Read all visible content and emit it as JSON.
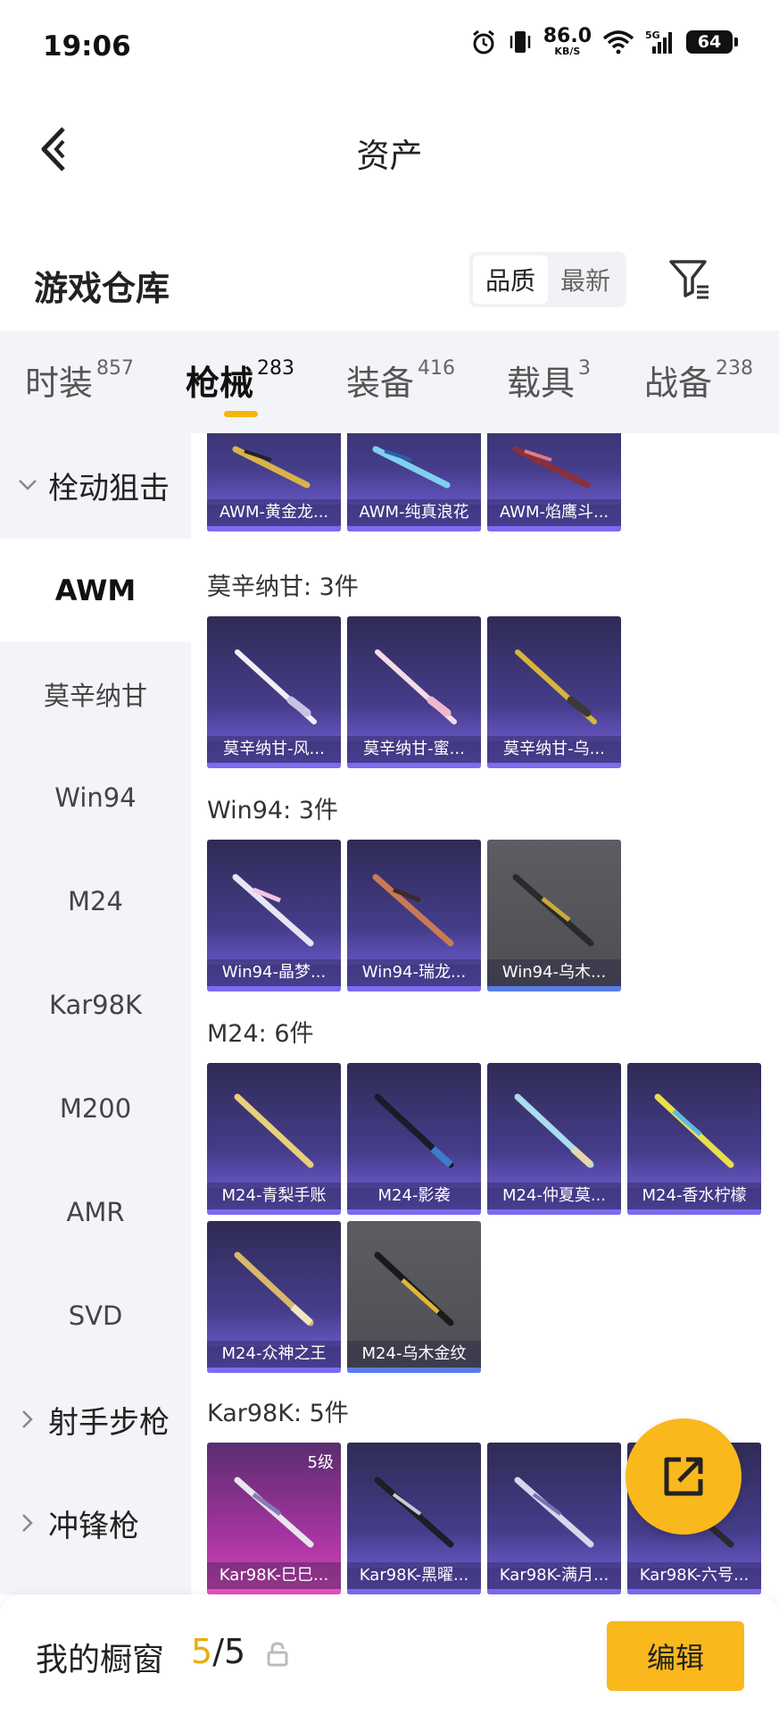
{
  "status_bar": {
    "time": "19:06",
    "net_speed": "86.0",
    "net_unit": "KB/S",
    "signal_label": "5G",
    "battery": "64",
    "icons": [
      "alarm-icon",
      "vibrate-icon",
      "wifi-icon",
      "signal-icon",
      "battery-icon"
    ]
  },
  "nav": {
    "title": "资产",
    "back_icon": "back-arrow-icon"
  },
  "warehouse": {
    "title": "游戏仓库",
    "sort_options": [
      "品质",
      "最新"
    ],
    "sort_selected": "品质",
    "filter_icon": "filter-icon"
  },
  "tabs": [
    {
      "label": "时装",
      "count": "857"
    },
    {
      "label": "枪械",
      "count": "283",
      "active": true
    },
    {
      "label": "装备",
      "count": "416"
    },
    {
      "label": "载具",
      "count": "3"
    },
    {
      "label": "战备",
      "count": "238"
    }
  ],
  "sidebar": {
    "groups": [
      {
        "label": "栓动狙击",
        "expanded": true
      },
      {
        "label": "射手步枪",
        "expanded": false
      },
      {
        "label": "冲锋枪",
        "expanded": false
      }
    ],
    "items": [
      "AWM",
      "莫辛纳甘",
      "Win94",
      "M24",
      "Kar98K",
      "M200",
      "AMR",
      "SVD"
    ],
    "selected": "AWM"
  },
  "sections": [
    {
      "label": "",
      "items": [
        "AWM-黄金龙...",
        "AWM-纯真浪花",
        "AWM-焰鹰斗..."
      ]
    },
    {
      "label": "莫辛纳甘: 3件",
      "items": [
        "莫辛纳甘-风...",
        "莫辛纳甘-蜜...",
        "莫辛纳甘-乌..."
      ]
    },
    {
      "label": "Win94: 3件",
      "items": [
        "Win94-晶梦...",
        "Win94-瑞龙...",
        "Win94-乌木..."
      ]
    },
    {
      "label": "M24: 6件",
      "items": [
        "M24-青梨手账",
        "M24-影袭",
        "M24-仲夏莫...",
        "M24-香水柠檬",
        "M24-众神之王",
        "M24-乌木金纹"
      ]
    },
    {
      "label": "Kar98K: 5件",
      "items": [
        "Kar98K-巳巳...",
        "Kar98K-黑曜...",
        "Kar98K-满月...",
        "Kar98K-六号..."
      ],
      "first_level": "5级"
    }
  ],
  "fab": {
    "icon": "share-external-icon"
  },
  "bottom": {
    "showcase_label": "我的橱窗",
    "showcase_current": "5",
    "showcase_sep": "/",
    "showcase_total": "5",
    "lock_icon": "lock-icon",
    "edit_label": "编辑"
  },
  "colors": {
    "accent": "#f9b81b",
    "card_purple": "#463d8c",
    "card_grey": "#4d4e54",
    "card_pink": "#a3349e",
    "sidebar_bg": "#f3f4f8"
  }
}
